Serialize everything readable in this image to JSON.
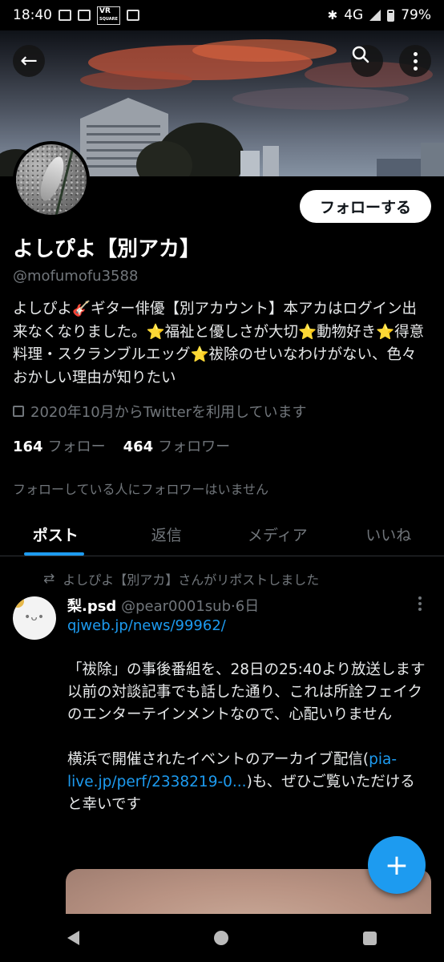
{
  "status_bar": {
    "time": "18:40",
    "network": "4G",
    "battery": "79%",
    "vr_badge_top": "VR",
    "vr_badge_bottom": "SQUARE"
  },
  "header": {
    "back_icon": "←",
    "search_icon": "search-icon",
    "more_icon": "more-vertical-icon"
  },
  "profile": {
    "follow_button": "フォローする",
    "display_name": "よしぴよ【別アカ】",
    "handle": "@mofumofu3588",
    "bio": "よしぴよ🎸ギター俳優【別アカウント】本アカはログイン出来なくなりました。⭐福祉と優しさが大切⭐動物好き⭐得意料理・スクランブルエッグ⭐祓除のせいなわけがない、色々おかしい理由が知りたい",
    "joined": "2020年10月からTwitterを利用しています",
    "following_count": "164",
    "following_label": "フォロー",
    "followers_count": "464",
    "followers_label": "フォロワー",
    "mutual_note": "フォローしている人にフォロワーはいません"
  },
  "tabs": [
    {
      "label": "ポスト",
      "active": true
    },
    {
      "label": "返信",
      "active": false
    },
    {
      "label": "メディア",
      "active": false
    },
    {
      "label": "いいね",
      "active": false
    }
  ],
  "post": {
    "repost_note": "よしぴよ【別アカ】さんがリポストしました",
    "author_name": "梨.psd",
    "author_handle": "@pear0001sub",
    "separator": "·",
    "time": "6日",
    "link1": "qjweb.jp/news/99962/",
    "body1": "「祓除」の事後番組を、28日の25:40より放送します",
    "body2": "以前の対談記事でも話した通り、これは所詮フェイクのエンターテインメントなので、心配いりません",
    "body3_pre": "横浜で開催されたイベントのアーカイブ配信(",
    "link2": "pia-live.jp/perf/2338219-0...",
    "body3_post": ")も、ぜひご覧いただけると幸いです"
  },
  "fab": {
    "label": "+"
  },
  "colors": {
    "accent": "#1d9bf0",
    "background": "#000000",
    "secondary_text": "#71767b"
  }
}
